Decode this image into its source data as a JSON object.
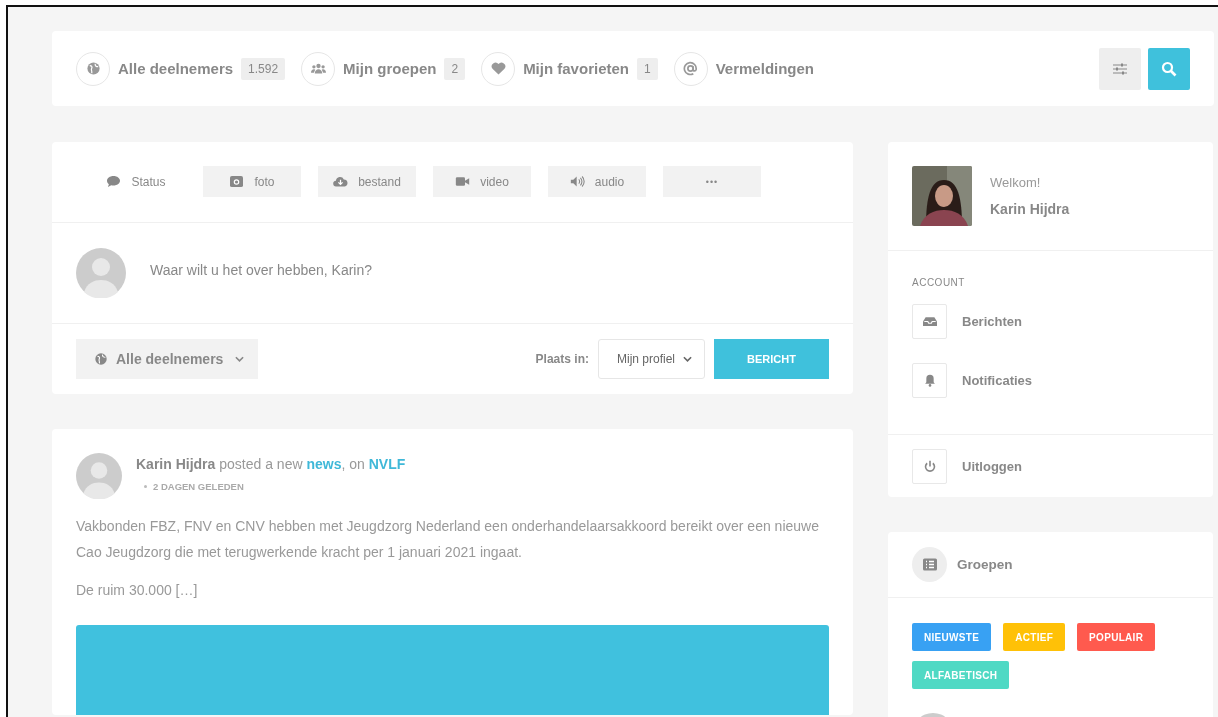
{
  "top_nav": {
    "items": [
      {
        "label": "Alle deelnemers",
        "count": "1.592"
      },
      {
        "label": "Mijn groepen",
        "count": "2"
      },
      {
        "label": "Mijn favorieten",
        "count": "1"
      },
      {
        "label": "Vermeldingen"
      }
    ]
  },
  "composer": {
    "tabs": [
      {
        "label": "Status",
        "selected": true
      },
      {
        "label": "foto",
        "selected": false
      },
      {
        "label": "bestand",
        "selected": false
      },
      {
        "label": "video",
        "selected": false
      },
      {
        "label": "audio",
        "selected": false
      },
      {
        "label": "•••",
        "selected": false
      }
    ],
    "placeholder": "Waar wilt u het over hebben, Karin?",
    "privacy": "Alle deelnemers",
    "post_in_label": "Plaats in:",
    "post_in": "Mijn profiel",
    "submit": "BERICHT"
  },
  "post": {
    "author": "Karin Hijdra",
    "action": "posted a new",
    "object": "news",
    "separator": ", on",
    "target": "NVLF",
    "time": "2 DAGEN GELEDEN",
    "paragraphs": [
      "Vakbonden FBZ, FNV en CNV hebben met Jeugdzorg Nederland een onderhandelaarsakkoord bereikt over een nieuwe Cao Jeugdzorg die met terugwerkende kracht per 1 januari 2021 ingaat.",
      "De ruim 30.000 […]"
    ]
  },
  "sidebar": {
    "welcome": "Welkom!",
    "name": "Karin Hijdra",
    "section": "ACCOUNT",
    "items": [
      {
        "label": "Berichten"
      },
      {
        "label": "Notificaties"
      }
    ],
    "logout": {
      "label": "Uitloggen"
    },
    "groups": {
      "title": "Groepen",
      "filters": [
        {
          "label": "NIEUWSTE",
          "color": "#38a1f3"
        },
        {
          "label": "ACTIEF",
          "color": "#ffc107"
        },
        {
          "label": "POPULAIR",
          "color": "#ff5a4e"
        },
        {
          "label": "ALFABETISCH",
          "color": "#4fd9c4"
        }
      ]
    }
  }
}
